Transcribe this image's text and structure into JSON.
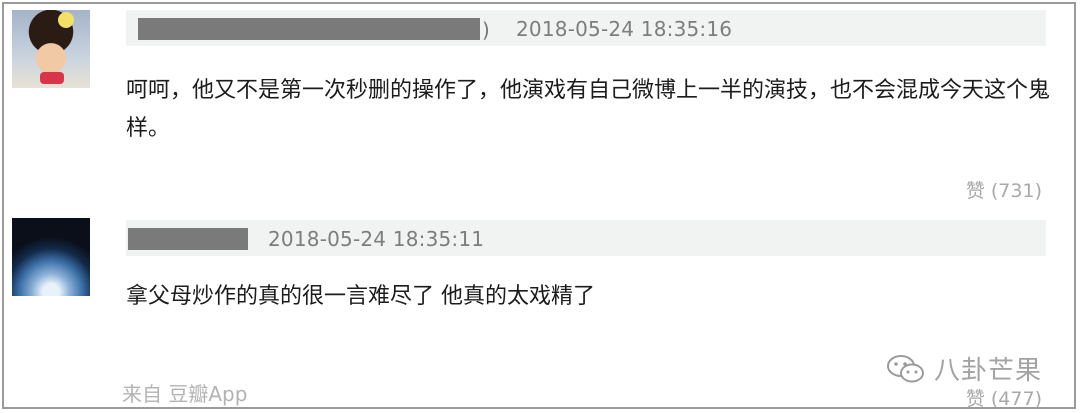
{
  "comments": [
    {
      "timestamp": "2018-05-24 18:35:16",
      "paren": ")",
      "text": "呵呵，他又不是第一次秒删的操作了，他演戏有自己微博上一半的演技，也不会混成今天这个鬼样。",
      "like": "赞 (731)"
    },
    {
      "timestamp": "2018-05-24 18:35:11",
      "text": "拿父母炒作的真的很一言难尽了 他真的太戏精了",
      "like": "赞 (477)",
      "source": "来自 豆瓣App"
    }
  ],
  "watermark": {
    "text": "八卦芒果",
    "icon": "wechat-icon"
  },
  "colors": {
    "meta_bar": "#f1f2f2",
    "redaction": "#7a7a7a",
    "border": "#9a9a9a"
  }
}
